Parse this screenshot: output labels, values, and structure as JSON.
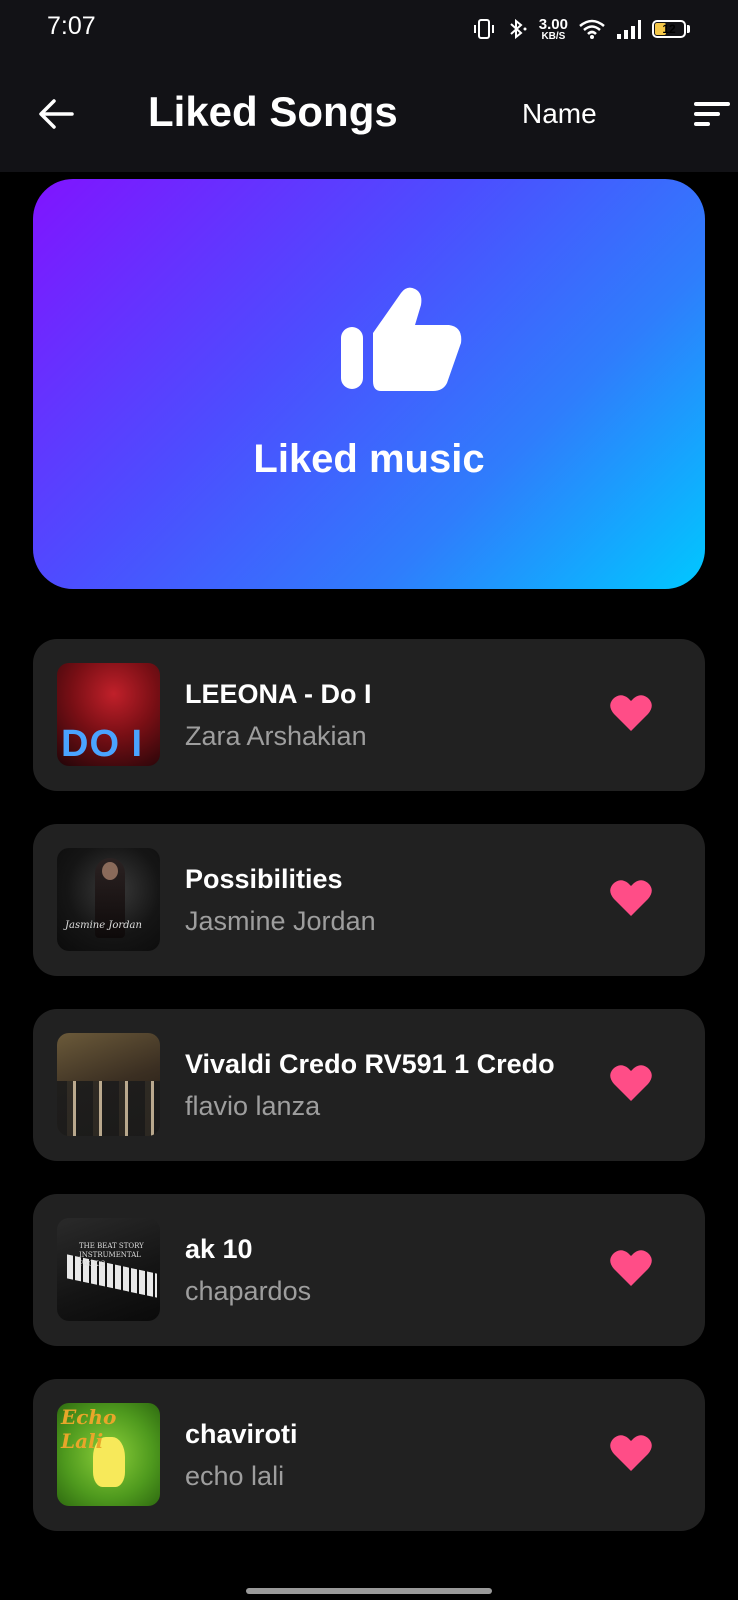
{
  "status_bar": {
    "time": "7:07",
    "net_speed_value": "3.00",
    "net_speed_unit": "KB/S",
    "battery_level": "12",
    "icons": [
      "vibrate-icon",
      "bluetooth-icon",
      "wifi-icon",
      "signal-icon",
      "battery-icon"
    ]
  },
  "app_bar": {
    "title": "Liked Songs",
    "sort_label": "Name",
    "back_icon": "arrow-left-icon",
    "sort_icon": "sort-lines-icon"
  },
  "hero": {
    "label": "Liked music",
    "icon": "thumbs-up-icon"
  },
  "songs": [
    {
      "title": "LEEONA - Do I",
      "artist": "Zara Arshakian",
      "cover_text": "DO I"
    },
    {
      "title": "Possibilities",
      "artist": "Jasmine Jordan",
      "cover_text": "Jasmine Jordan"
    },
    {
      "title": "Vivaldi Credo RV591 1 Credo",
      "artist": "flavio lanza"
    },
    {
      "title": "ak 10",
      "artist": "chapardos",
      "cover_text": "THE BEAT STORY INSTRUMENTAL PACK 3"
    },
    {
      "title": "chaviroti",
      "artist": "echo lali",
      "cover_text": "Echo Lali"
    }
  ],
  "colors": {
    "background": "#000000",
    "card": "#212121",
    "heart": "#ff4d87",
    "artist_text": "#9e9e9e",
    "gradient_start": "#8014ff",
    "gradient_end": "#00c8ff"
  }
}
